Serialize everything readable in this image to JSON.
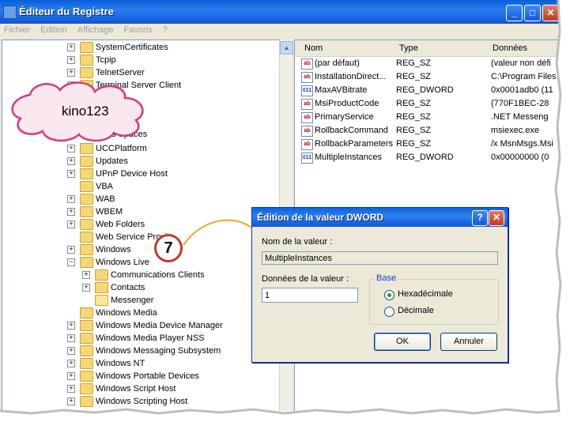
{
  "window": {
    "title": "Éditeur du Registre",
    "menu": [
      "Fichier",
      "Edition",
      "Affichage",
      "Favoris",
      "?"
    ]
  },
  "tree_items": [
    {
      "label": "SystemCertificates",
      "level": 0,
      "expander": "+"
    },
    {
      "label": "Tcpip",
      "level": 0,
      "expander": "+"
    },
    {
      "label": "TelnetServer",
      "level": 0,
      "expander": "+"
    },
    {
      "label": "Terminal Server Client",
      "level": 0,
      "expander": "+"
    },
    {
      "label": "UCCPlatform",
      "level": 0,
      "expander": "+"
    },
    {
      "label": "Updates",
      "level": 0,
      "expander": "+"
    },
    {
      "label": "UPnP Device Host",
      "level": 0,
      "expander": "+"
    },
    {
      "label": "VBA",
      "level": 0,
      "expander": ""
    },
    {
      "label": "WAB",
      "level": 0,
      "expander": "+"
    },
    {
      "label": "WBEM",
      "level": 0,
      "expander": "+"
    },
    {
      "label": "Web Folders",
      "level": 0,
      "expander": "+"
    },
    {
      "label": "Web Service Provi",
      "level": 0,
      "expander": ""
    },
    {
      "label": "Windows",
      "level": 0,
      "expander": "+"
    },
    {
      "label": "Windows Live",
      "level": 0,
      "expander": "−"
    },
    {
      "label": "Communications Clients",
      "level": 1,
      "expander": "+"
    },
    {
      "label": "Contacts",
      "level": 1,
      "expander": "+"
    },
    {
      "label": "Messenger",
      "level": 1,
      "expander": "",
      "open": true
    },
    {
      "label": "Windows Media",
      "level": 0,
      "expander": ""
    },
    {
      "label": "Windows Media Device Manager",
      "level": 0,
      "expander": "+"
    },
    {
      "label": "Windows Media Player NSS",
      "level": 0,
      "expander": "+"
    },
    {
      "label": "Windows Messaging Subsystem",
      "level": 0,
      "expander": "+"
    },
    {
      "label": "Windows NT",
      "level": 0,
      "expander": "+"
    },
    {
      "label": "Windows Portable Devices",
      "level": 0,
      "expander": "+"
    },
    {
      "label": "Windows Script Host",
      "level": 0,
      "expander": "+"
    },
    {
      "label": "Windows Scripting Host",
      "level": 0,
      "expander": "+"
    }
  ],
  "tree_partial": "s Spaces",
  "list": {
    "columns": [
      "Nom",
      "Type",
      "Données"
    ],
    "rows": [
      {
        "name": "(par défaut)",
        "type": "REG_SZ",
        "data": "(valeur non défi",
        "icon": "ab"
      },
      {
        "name": "InstallationDirect...",
        "type": "REG_SZ",
        "data": "C:\\Program Files",
        "icon": "ab"
      },
      {
        "name": "MaxAVBitrate",
        "type": "REG_DWORD",
        "data": "0x0001adb0 (11",
        "icon": "dword"
      },
      {
        "name": "MsiProductCode",
        "type": "REG_SZ",
        "data": "{770F1BEC-28",
        "icon": "ab"
      },
      {
        "name": "PrimaryService",
        "type": "REG_SZ",
        "data": ".NET Messeng",
        "icon": "ab"
      },
      {
        "name": "RollbackCommand",
        "type": "REG_SZ",
        "data": "msiexec.exe",
        "icon": "ab"
      },
      {
        "name": "RollbackParameters",
        "type": "REG_SZ",
        "data": "/x MsnMsgs.Msi",
        "icon": "ab"
      },
      {
        "name": "MultipleInstances",
        "type": "REG_DWORD",
        "data": "0x00000000 (0",
        "icon": "dword"
      }
    ]
  },
  "cloud_text": "kino123",
  "step_badge": "7",
  "dialog": {
    "title": "Édition de la valeur DWORD",
    "help": "?",
    "close": "✕",
    "name_label": "Nom de la valeur :",
    "name_value": "MultipleInstances",
    "data_label": "Données de la valeur :",
    "data_value": "1",
    "base_label": "Base",
    "hex_label": "Hexadécimale",
    "dec_label": "Décimale",
    "selected_base": "hex",
    "ok": "OK",
    "cancel": "Annuler"
  }
}
